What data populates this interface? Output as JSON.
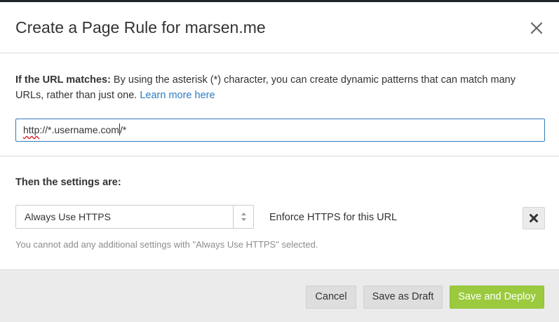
{
  "modal": {
    "title": "Create a Page Rule for marsen.me"
  },
  "icons": {
    "close": "close-icon",
    "select_arrows": "updown-arrows-icon",
    "remove": "x-icon"
  },
  "url_section": {
    "label": "If the URL matches:",
    "description": " By using the asterisk (*) character, you can create dynamic patterns that can match many URLs, rather than just one. ",
    "learn_more": "Learn more here",
    "input_value_spell": "http",
    "input_value_mid": "://*.username.com",
    "input_value_end": "/*"
  },
  "settings_section": {
    "heading": "Then the settings are:",
    "selected_setting": "Always Use HTTPS",
    "setting_description": "Enforce HTTPS for this URL",
    "note": "You cannot add any additional settings with \"Always Use HTTPS\" selected."
  },
  "footer": {
    "cancel_label": "Cancel",
    "draft_label": "Save as Draft",
    "deploy_label": "Save and Deploy"
  },
  "colors": {
    "link": "#2f7bbf",
    "deploy": "#9bca3e",
    "footer_bg": "#ebebeb"
  }
}
